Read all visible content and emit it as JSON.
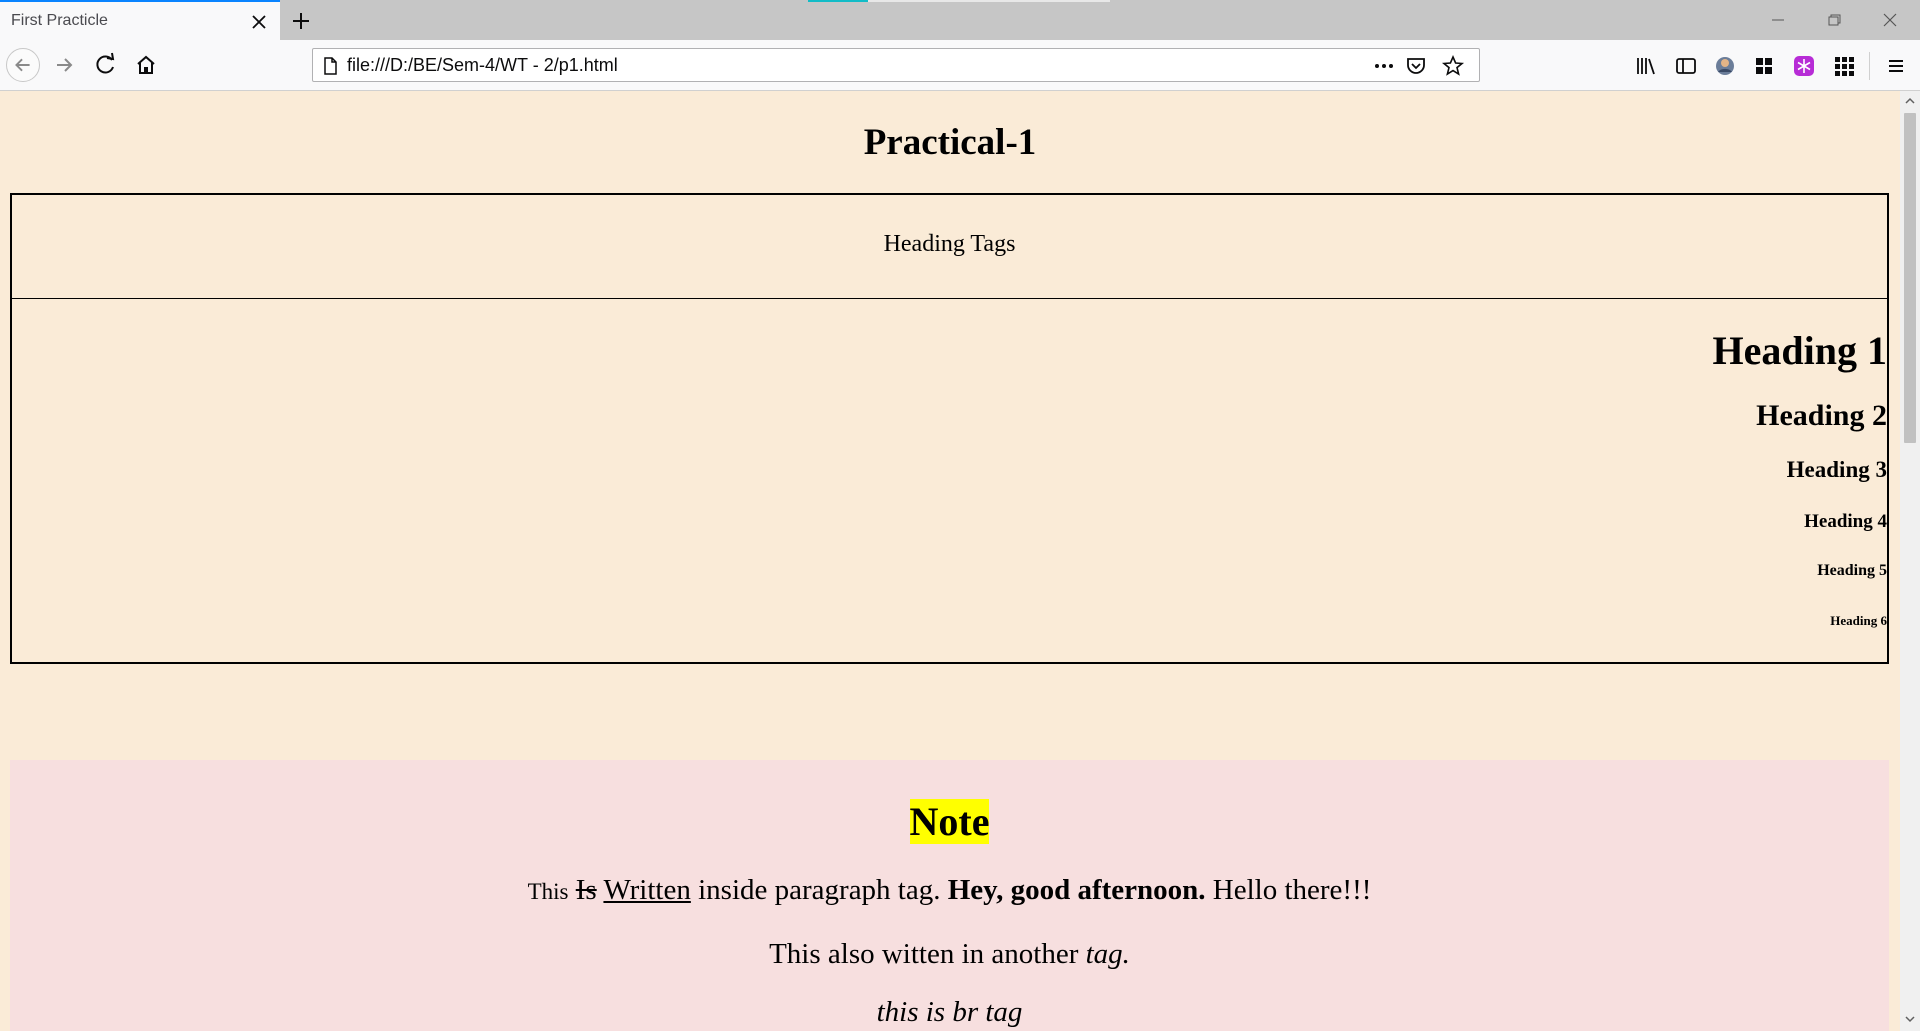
{
  "browser": {
    "tab_title": "First Practicle",
    "url": "file:///D:/BE/Sem-4/WT - 2/p1.html"
  },
  "page": {
    "title": "Practical-1",
    "table_header": "Heading Tags",
    "headings": [
      "Heading 1",
      "Heading 2",
      "Heading 3",
      "Heading 4",
      "Heading 5",
      "Heading 6"
    ],
    "note": {
      "title": "Note",
      "para1": {
        "this": "This",
        "is_struck": "Is",
        "written_underlined": "Written",
        "rest": "inside paragraph tag.",
        "bold": "Hey, good afternoon.",
        "end": "Hello there!!!"
      },
      "para2": {
        "text": "This also witten in another",
        "italic": "tag."
      },
      "para3": "this is br tag"
    }
  },
  "colors": {
    "page_bg": "#faebd7",
    "note_bg": "#f7dfdf",
    "highlight": "#ffff00",
    "tab_accent": "#0a84ff"
  }
}
